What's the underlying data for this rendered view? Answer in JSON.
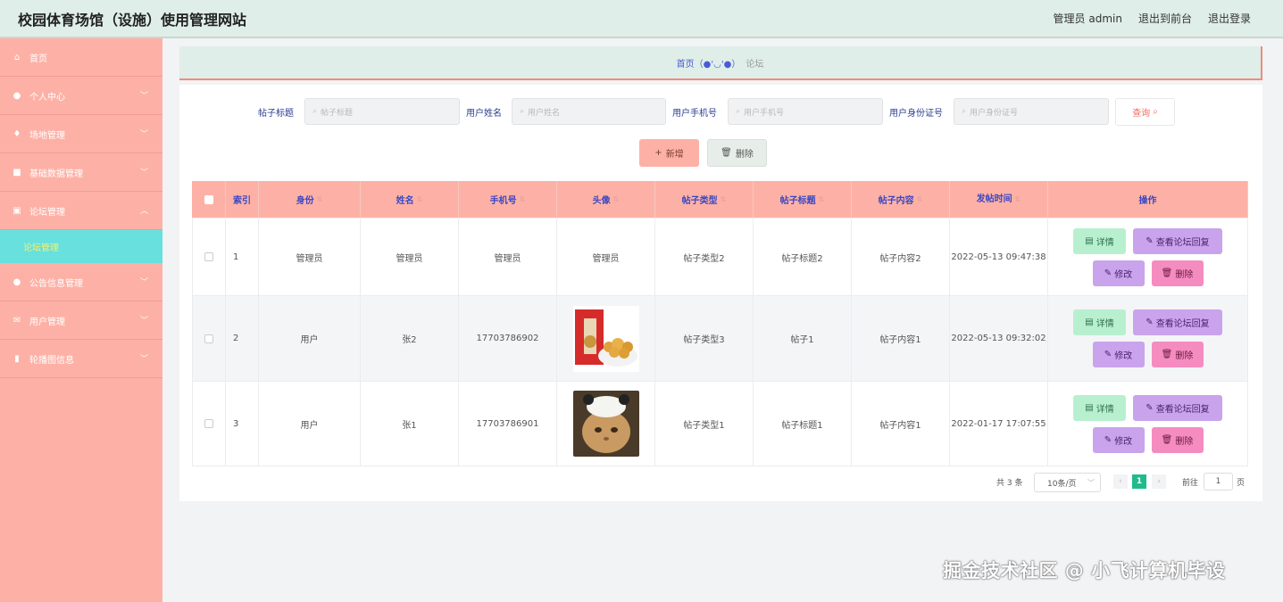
{
  "header": {
    "title": "校园体育场馆（设施）使用管理网站",
    "user": "管理员 admin",
    "back_front": "退出到前台",
    "logout": "退出登录"
  },
  "sidebar": {
    "items": [
      {
        "label": "首页",
        "icon": "home-icon"
      },
      {
        "label": "个人中心",
        "icon": "user-icon"
      },
      {
        "label": "场地管理",
        "icon": "microphone-icon"
      },
      {
        "label": "基础数据管理",
        "icon": "document-icon"
      },
      {
        "label": "论坛管理",
        "icon": "briefcase-icon"
      },
      {
        "label": "论坛管理",
        "icon": ""
      },
      {
        "label": "公告信息管理",
        "icon": "pin-icon"
      },
      {
        "label": "用户管理",
        "icon": "mail-icon"
      },
      {
        "label": "轮播图信息",
        "icon": "chart-icon"
      }
    ]
  },
  "breadcrumb": {
    "home": "首页（●'◡'●）",
    "current": "论坛"
  },
  "search": {
    "fields": [
      {
        "label": "帖子标题",
        "placeholder": "帖子标题"
      },
      {
        "label": "用户姓名",
        "placeholder": "用户姓名"
      },
      {
        "label": "用户手机号",
        "placeholder": "用户手机号"
      },
      {
        "label": "用户身份证号",
        "placeholder": "用户身份证号"
      }
    ],
    "query_label": "查询"
  },
  "actions": {
    "add_label": "新增",
    "delete_label": "删除"
  },
  "table": {
    "headers": [
      "索引",
      "身份",
      "姓名",
      "手机号",
      "头像",
      "帖子类型",
      "帖子标题",
      "帖子内容",
      "发帖时间",
      "操作"
    ],
    "rows": [
      {
        "index": "1",
        "role": "管理员",
        "name": "管理员",
        "phone": "管理员",
        "avatar": "管理员",
        "type": "帖子类型2",
        "title": "帖子标题2",
        "content": "帖子内容2",
        "time": "2022-05-13 09:47:38"
      },
      {
        "index": "2",
        "role": "用户",
        "name": "张2",
        "phone": "17703786902",
        "avatar": "",
        "type": "帖子类型3",
        "title": "帖子1",
        "content": "帖子内容1",
        "time": "2022-05-13 09:32:02"
      },
      {
        "index": "3",
        "role": "用户",
        "name": "张1",
        "phone": "17703786901",
        "avatar": "",
        "type": "帖子类型1",
        "title": "帖子标题1",
        "content": "帖子内容1",
        "time": "2022-01-17 17:07:55"
      }
    ],
    "ops": {
      "detail": "详情",
      "reply": "查看论坛回复",
      "edit": "修改",
      "remove": "删除"
    }
  },
  "pagination": {
    "total": "共 3 条",
    "page_size": "10条/页",
    "current_page": "1",
    "goto": "前往",
    "goto_value": "1",
    "page_unit": "页"
  },
  "watermark": "掘金技术社区 @ 小飞计算机毕设",
  "colors": {
    "sidebar": "#fdb1a6",
    "header": "#dfeee8",
    "active_sub": "#67e0de",
    "page_active": "#1fbb8a"
  }
}
